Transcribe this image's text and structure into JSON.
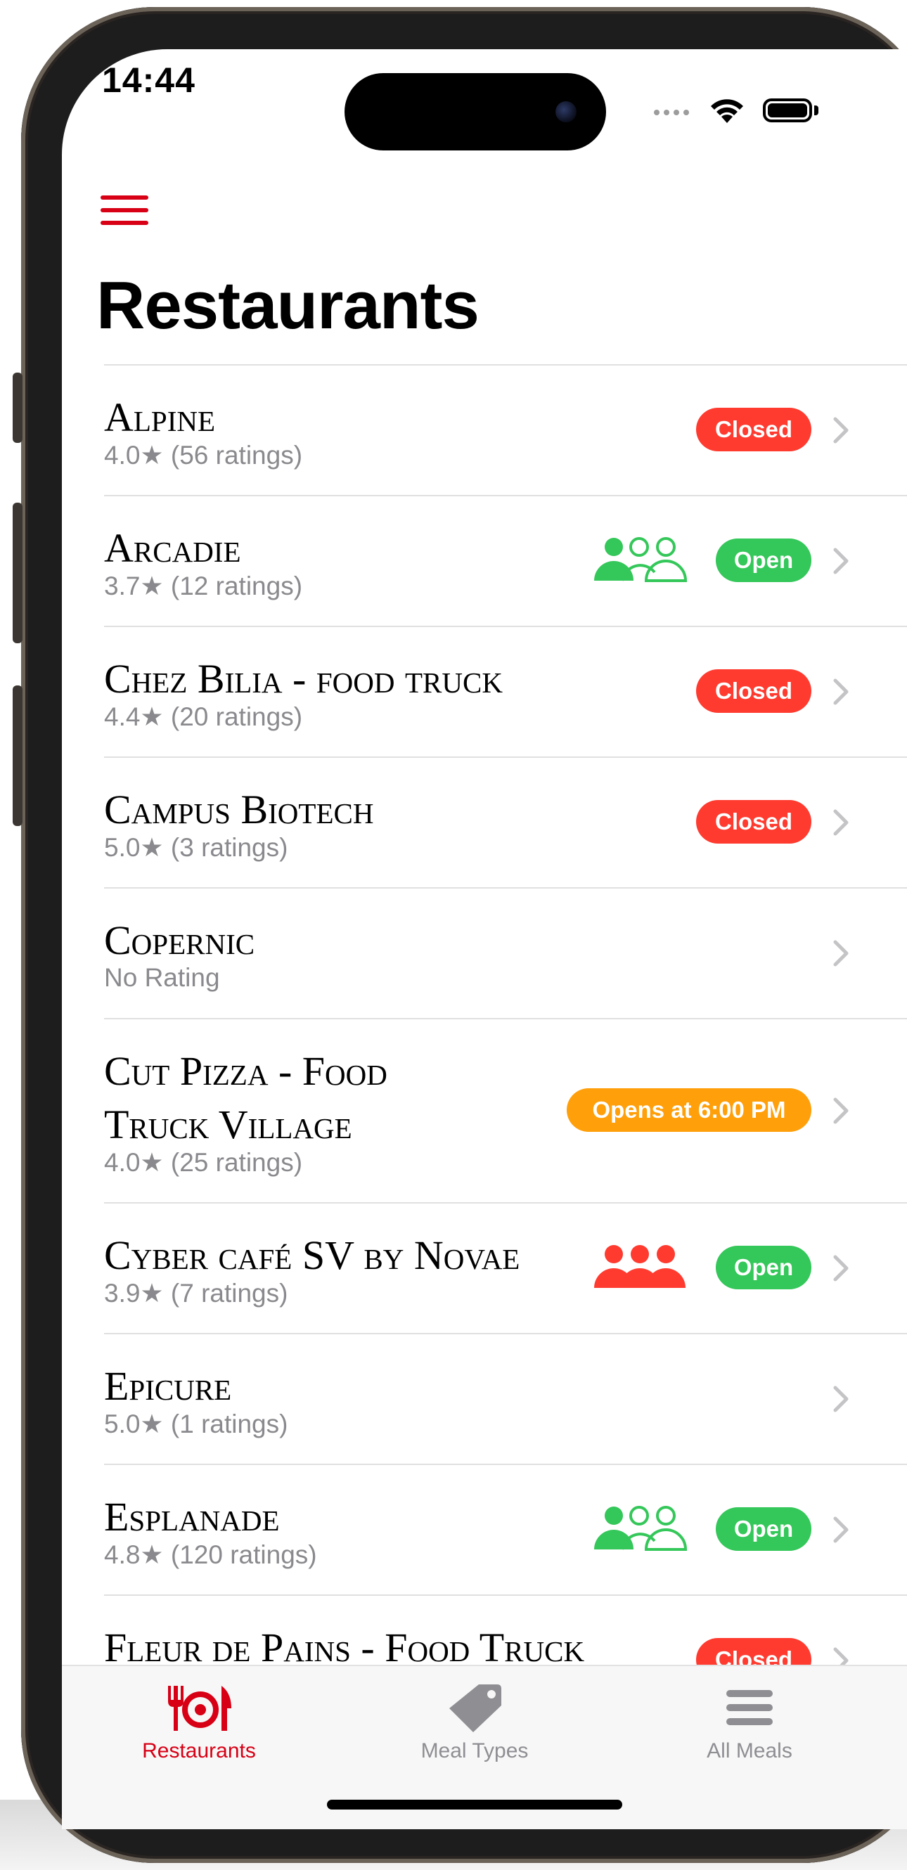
{
  "status_bar": {
    "time": "14:44"
  },
  "nav": {
    "title": "Restaurants"
  },
  "restaurants": [
    {
      "name": "Alpine",
      "rating": "4.0★ (56 ratings)",
      "status": "Closed",
      "status_type": "closed",
      "crowd": ""
    },
    {
      "name": "Arcadie",
      "rating": "3.7★ (12 ratings)",
      "status": "Open",
      "status_type": "open",
      "crowd": "low"
    },
    {
      "name": "Chez Bilia - food truck",
      "rating": "4.4★ (20 ratings)",
      "status": "Closed",
      "status_type": "closed",
      "crowd": ""
    },
    {
      "name": "Campus Biotech",
      "rating": "5.0★ (3 ratings)",
      "status": "Closed",
      "status_type": "closed",
      "crowd": ""
    },
    {
      "name": "Copernic",
      "rating": "No Rating",
      "status": "",
      "status_type": "",
      "crowd": ""
    },
    {
      "name_line1": "Cut Pizza - Food",
      "name_line2": "Truck Village",
      "rating": "4.0★ (25 ratings)",
      "status": "Opens at 6:00 PM",
      "status_type": "soon",
      "crowd": ""
    },
    {
      "name": "Cyber café SV by Novae",
      "rating": "3.9★ (7 ratings)",
      "status": "Open",
      "status_type": "open",
      "crowd": "high"
    },
    {
      "name": "Epicure",
      "rating": "5.0★ (1 ratings)",
      "status": "",
      "status_type": "",
      "crowd": ""
    },
    {
      "name": "Esplanade",
      "rating": "4.8★ (120 ratings)",
      "status": "Open",
      "status_type": "open",
      "crowd": "low"
    },
    {
      "name": "Fleur de Pains - Food Truck",
      "rating": "",
      "status": "Closed",
      "status_type": "closed",
      "crowd": ""
    }
  ],
  "tabs": [
    {
      "label": "Restaurants",
      "icon": "fork-plate-knife-icon",
      "selected": true
    },
    {
      "label": "Meal Types",
      "icon": "tag-icon",
      "selected": false
    },
    {
      "label": "All Meals",
      "icon": "list-icon",
      "selected": false
    }
  ],
  "colors": {
    "accent": "#d70015",
    "closed": "#ff3b30",
    "open": "#34c759",
    "soon": "#ff9f0a",
    "crowd_low": "#34c759",
    "crowd_high": "#ff3b30"
  }
}
